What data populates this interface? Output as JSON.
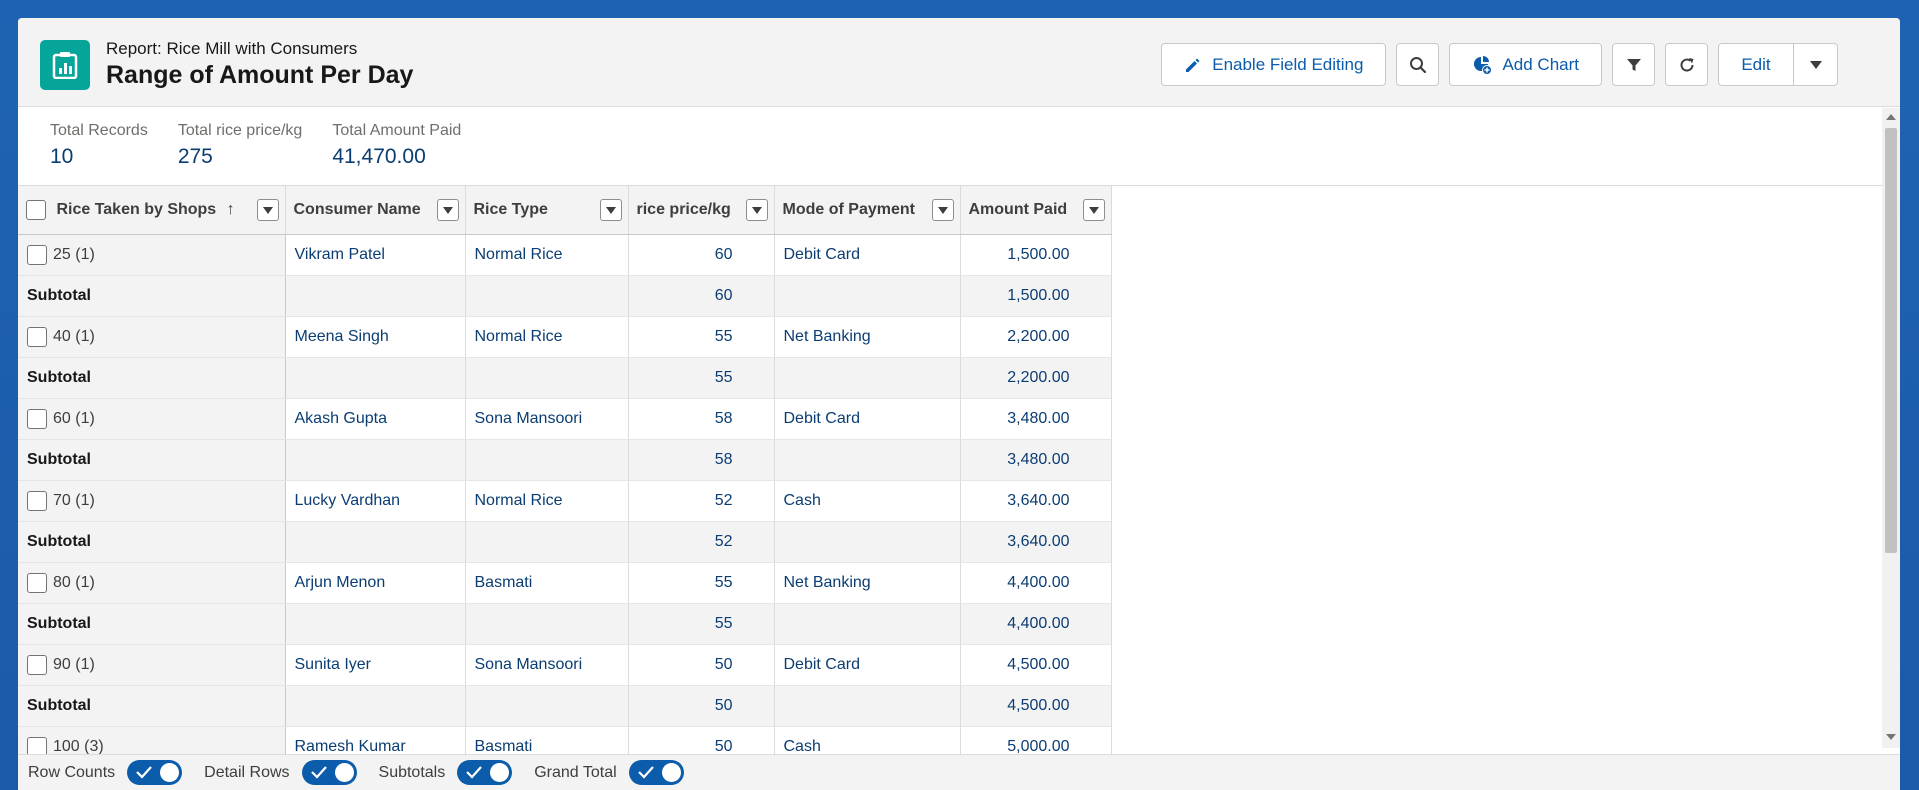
{
  "header": {
    "subtitle": "Report: Rice Mill with Consumers",
    "title": "Range of Amount Per Day"
  },
  "actions": {
    "enable_field_editing": "Enable Field Editing",
    "add_chart": "Add Chart",
    "edit": "Edit"
  },
  "summary": [
    {
      "label": "Total Records",
      "value": "10"
    },
    {
      "label": "Total rice price/kg",
      "value": "275"
    },
    {
      "label": "Total Amount Paid",
      "value": "41,470.00"
    }
  ],
  "table": {
    "columns": [
      "Rice Taken by Shops",
      "Consumer Name",
      "Rice Type",
      "rice price/kg",
      "Mode of Payment",
      "Amount Paid"
    ],
    "sort_indicator": "↑",
    "subtotal_label": "Subtotal",
    "groups": [
      {
        "group": "25 (1)",
        "consumer": "Vikram Patel",
        "rice_type": "Normal Rice",
        "price": "60",
        "payment": "Debit Card",
        "amount": "1,500.00",
        "sub_price": "60",
        "sub_amount": "1,500.00"
      },
      {
        "group": "40 (1)",
        "consumer": "Meena Singh",
        "rice_type": "Normal Rice",
        "price": "55",
        "payment": "Net Banking",
        "amount": "2,200.00",
        "sub_price": "55",
        "sub_amount": "2,200.00"
      },
      {
        "group": "60 (1)",
        "consumer": "Akash Gupta",
        "rice_type": "Sona Mansoori",
        "price": "58",
        "payment": "Debit Card",
        "amount": "3,480.00",
        "sub_price": "58",
        "sub_amount": "3,480.00"
      },
      {
        "group": "70 (1)",
        "consumer": "Lucky Vardhan",
        "rice_type": "Normal Rice",
        "price": "52",
        "payment": "Cash",
        "amount": "3,640.00",
        "sub_price": "52",
        "sub_amount": "3,640.00"
      },
      {
        "group": "80 (1)",
        "consumer": "Arjun Menon",
        "rice_type": "Basmati",
        "price": "55",
        "payment": "Net Banking",
        "amount": "4,400.00",
        "sub_price": "55",
        "sub_amount": "4,400.00"
      },
      {
        "group": "90 (1)",
        "consumer": "Sunita Iyer",
        "rice_type": "Sona Mansoori",
        "price": "50",
        "payment": "Debit Card",
        "amount": "4,500.00",
        "sub_price": "50",
        "sub_amount": "4,500.00"
      },
      {
        "group": "100 (3)",
        "consumer": "Ramesh Kumar",
        "rice_type": "Basmati",
        "price": "50",
        "payment": "Cash",
        "amount": "5,000.00"
      }
    ]
  },
  "footer": {
    "toggles": [
      {
        "label": "Row Counts",
        "on": true
      },
      {
        "label": "Detail Rows",
        "on": true
      },
      {
        "label": "Subtotals",
        "on": true
      },
      {
        "label": "Grand Total",
        "on": true
      }
    ]
  },
  "colors": {
    "accent": "#0b5cab",
    "icon_bg": "#06a59a",
    "background": "#1b5fae"
  }
}
